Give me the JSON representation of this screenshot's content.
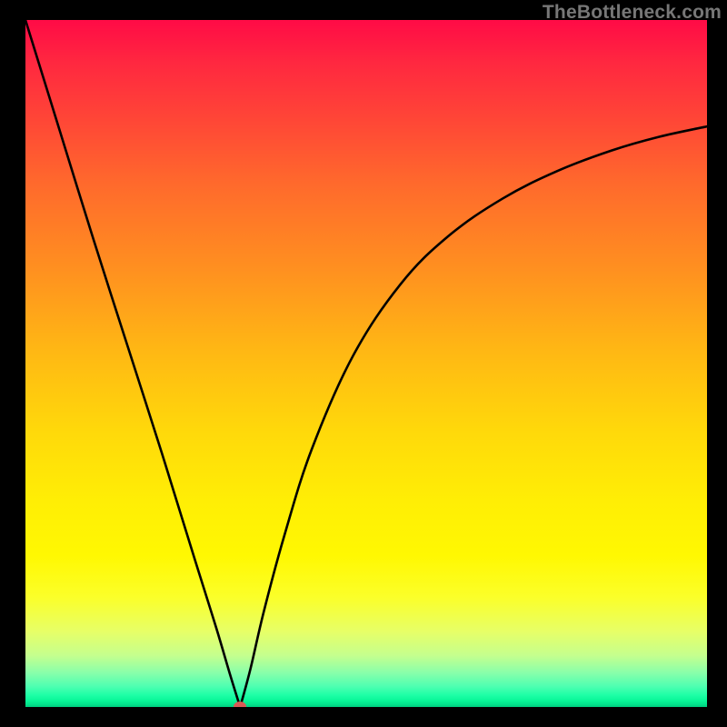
{
  "watermark": "TheBottleneck.com",
  "colors": {
    "frame": "#000000",
    "curve": "#000000",
    "marker": "#d85a56",
    "gradient_stops": [
      {
        "pct": 0,
        "hex": "#ff0b46"
      },
      {
        "pct": 6,
        "hex": "#ff2740"
      },
      {
        "pct": 14,
        "hex": "#ff4437"
      },
      {
        "pct": 24,
        "hex": "#ff6a2c"
      },
      {
        "pct": 36,
        "hex": "#ff8f20"
      },
      {
        "pct": 48,
        "hex": "#ffb714"
      },
      {
        "pct": 60,
        "hex": "#ffd90a"
      },
      {
        "pct": 70,
        "hex": "#ffee05"
      },
      {
        "pct": 78,
        "hex": "#fff802"
      },
      {
        "pct": 84,
        "hex": "#fbff29"
      },
      {
        "pct": 89,
        "hex": "#e7ff67"
      },
      {
        "pct": 92.5,
        "hex": "#c5ff8e"
      },
      {
        "pct": 95,
        "hex": "#89ffaa"
      },
      {
        "pct": 97,
        "hex": "#4effb1"
      },
      {
        "pct": 98.3,
        "hex": "#1dffa6"
      },
      {
        "pct": 99.1,
        "hex": "#08f597"
      },
      {
        "pct": 99.6,
        "hex": "#03e48c"
      },
      {
        "pct": 100,
        "hex": "#00cb7e"
      }
    ]
  },
  "chart_data": {
    "type": "line",
    "title": "",
    "xlabel": "",
    "ylabel": "",
    "xlim": [
      0,
      100
    ],
    "ylim": [
      0,
      100
    ],
    "notch_x": 31.5,
    "marker": {
      "x": 31.5,
      "y": 0
    },
    "series": [
      {
        "name": "bottleneck-curve",
        "x": [
          0,
          5,
          10,
          15,
          20,
          25,
          28,
          30,
          31.5,
          33,
          35,
          38,
          42,
          48,
          55,
          62,
          70,
          78,
          86,
          93,
          100
        ],
        "values": [
          100,
          84.0,
          68.0,
          52.5,
          37.0,
          21.0,
          11.5,
          4.8,
          0,
          5.5,
          14.0,
          25.0,
          37.5,
          51.0,
          61.5,
          68.5,
          74.0,
          78.0,
          81.0,
          83.0,
          84.5
        ]
      }
    ]
  }
}
